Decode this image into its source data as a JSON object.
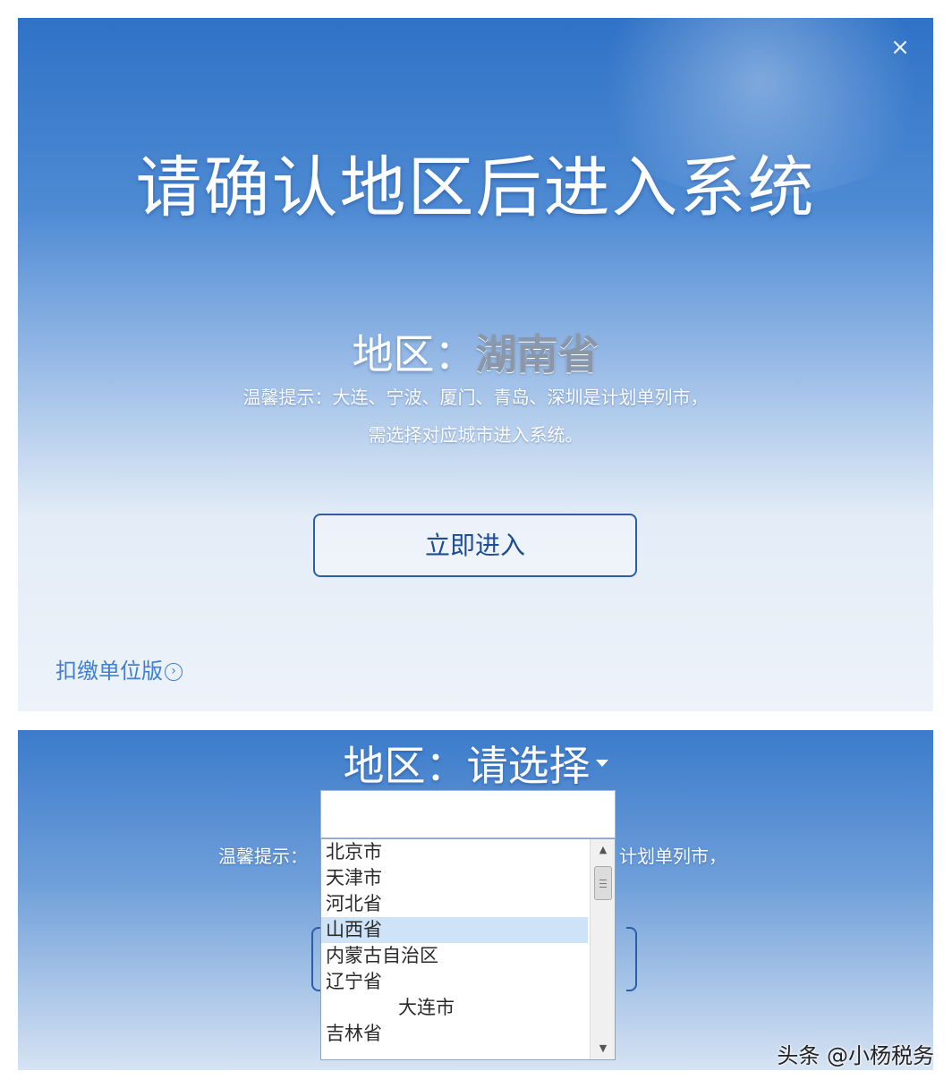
{
  "dialog": {
    "title": "请确认地区后进入系统",
    "close_symbol": "×",
    "region_label": "地区：",
    "region_value": "湖南省",
    "tip_line1": "温馨提示：大连、宁波、厦门、青岛、深圳是计划单列市，",
    "tip_line2": "需选择对应城市进入系统。",
    "enter_button": "立即进入",
    "withhold_link": "扣缴单位版",
    "withhold_link_icon": "›"
  },
  "dropdown_view": {
    "region_label": "地区：",
    "region_placeholder": "请选择",
    "tip_left": "温馨提示：",
    "tip_right": "计划单列市，",
    "search_value": "",
    "options": [
      {
        "label": "北京市"
      },
      {
        "label": "天津市"
      },
      {
        "label": "河北省"
      },
      {
        "label": "山西省"
      },
      {
        "label": "内蒙古自治区"
      },
      {
        "label": "辽宁省"
      },
      {
        "label": "大连市"
      },
      {
        "label": "吉林省"
      }
    ],
    "selected_option": "山西省",
    "scroll_up": "▲",
    "scroll_down": "▼"
  },
  "watermark": "头条 @小杨税务",
  "colors": {
    "accent": "#2a5ea8",
    "link": "#3f7fd0",
    "selected_row": "#cfe3f8"
  }
}
